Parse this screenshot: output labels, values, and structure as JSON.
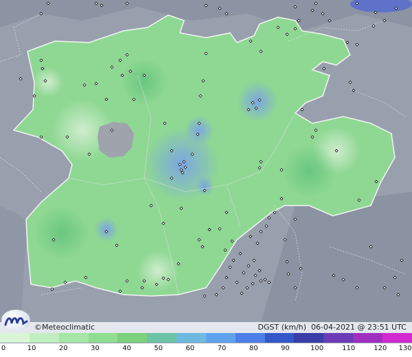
{
  "map": {
    "credit": "©Meteoclimatic",
    "variable_label": "DGST (km/h)",
    "date": "06-04-2021",
    "time": "23:51 UTC",
    "legend": {
      "ticks": [
        "0",
        "10",
        "20",
        "30",
        "40",
        "50",
        "60",
        "70",
        "80",
        "90",
        "100",
        "110",
        "120",
        "130"
      ],
      "colors": [
        "#d9f7d7",
        "#c0eec0",
        "#a6e6a6",
        "#8fdd91",
        "#7bd17e",
        "#6cc3a6",
        "#6fb9e0",
        "#5fa3ee",
        "#4c7fe8",
        "#3558c9",
        "#3a3ea9",
        "#6b3bb8",
        "#a030c0",
        "#d22ad0"
      ]
    },
    "stations_hint": "diamond-station-markers"
  }
}
